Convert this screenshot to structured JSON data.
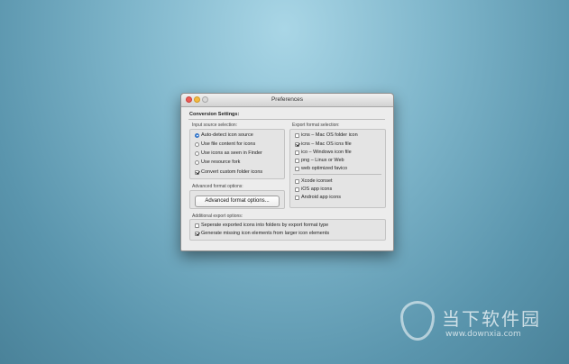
{
  "window": {
    "title": "Preferences"
  },
  "conversion_settings_label": "Conversion Settings:",
  "input_source": {
    "label": "Input source selection:",
    "radios": [
      {
        "label": "Auto-detect icon source",
        "selected": true
      },
      {
        "label": "Use file content for icons",
        "selected": false
      },
      {
        "label": "Use icons as seen in Finder",
        "selected": false
      },
      {
        "label": "Use resource fork",
        "selected": false
      }
    ],
    "convert_custom": {
      "label": "Convert custom folder icons",
      "checked": true
    }
  },
  "advanced": {
    "label": "Advanced format options:",
    "button_label": "Advanced format options..."
  },
  "export_format": {
    "label": "Export format selection:",
    "options": [
      {
        "label": "icns – Mac OS folder icon",
        "checked": false
      },
      {
        "label": "icns – Mac OS icns file",
        "checked": true
      },
      {
        "label": "ico  – Windows icon file",
        "checked": false
      },
      {
        "label": "png  – Linux or Web",
        "checked": false
      },
      {
        "label": "web optimized favico",
        "checked": false
      }
    ],
    "extra_options": [
      {
        "label": "Xcode iconset",
        "checked": false
      },
      {
        "label": "iOS app icons",
        "checked": false
      },
      {
        "label": "Android app icons",
        "checked": false
      }
    ]
  },
  "additional": {
    "label": "Additional export options:",
    "options": [
      {
        "label": "Seperate exported icons into folders by export format type",
        "checked": false
      },
      {
        "label": "Generate missing icon elements from larger icon elements",
        "checked": true
      }
    ]
  },
  "watermark": {
    "text_cn": "当下软件园",
    "url": "www.downxia.com"
  },
  "colors": {
    "accent": "#4a8ee0",
    "close": "#ec5b56",
    "minimize": "#f3b93f"
  }
}
